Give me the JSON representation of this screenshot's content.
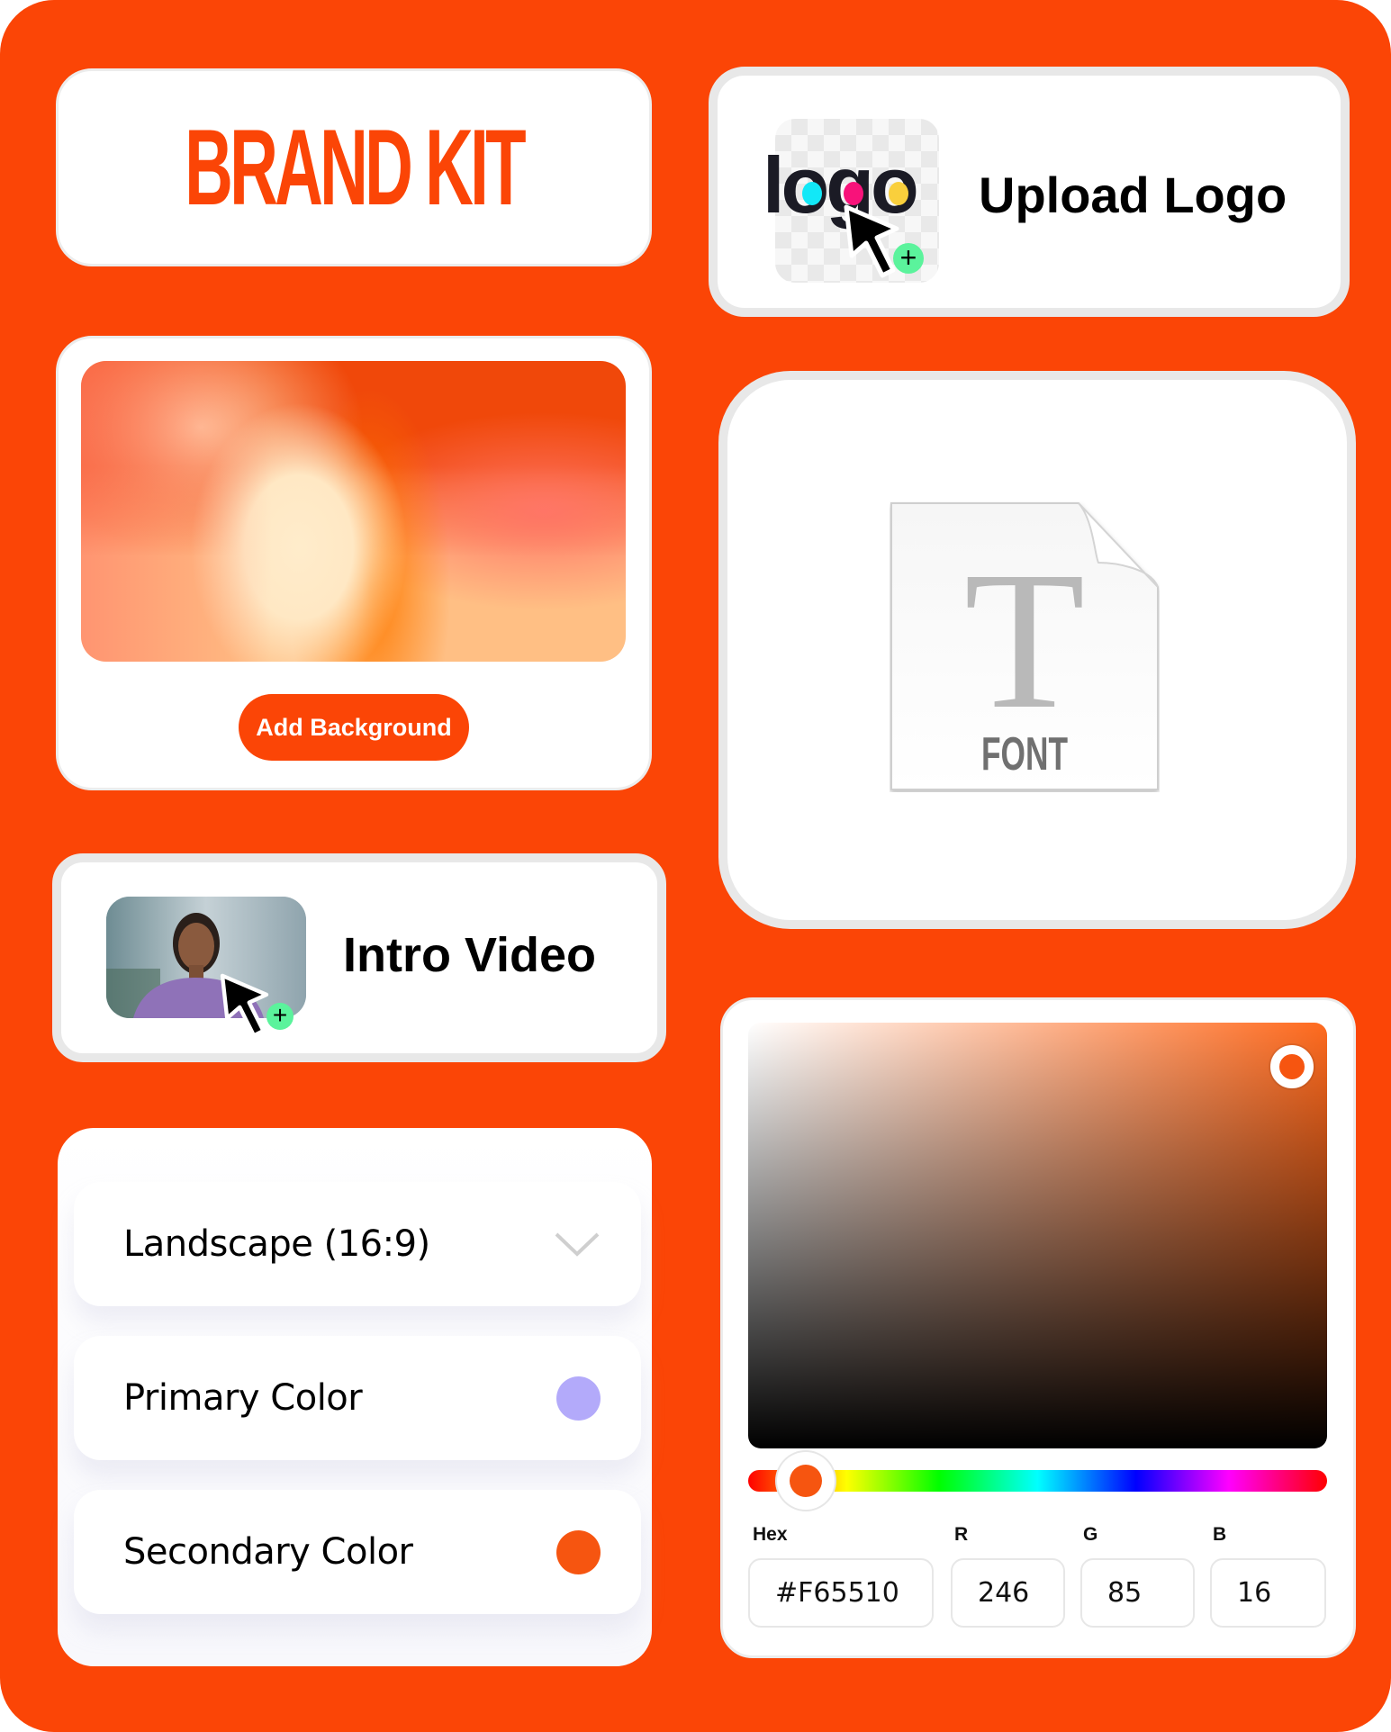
{
  "brand_kit": {
    "title": "BRAND KIT"
  },
  "upload_logo": {
    "label": "Upload Logo",
    "logo_text": "logo",
    "logo_dot_colors": [
      "#12e8f7",
      "#f8127a",
      "#f9cf3c"
    ],
    "badge": "+"
  },
  "background": {
    "button_label": "Add Background"
  },
  "font": {
    "file_glyph": "T",
    "file_label": "FONT"
  },
  "intro_video": {
    "label": "Intro Video",
    "badge": "+"
  },
  "settings": {
    "aspect_ratio": {
      "value": "Landscape (16:9)"
    },
    "primary_color": {
      "label": "Primary Color",
      "color": "#b3aafa"
    },
    "secondary_color": {
      "label": "Secondary Color",
      "color": "#f65510"
    }
  },
  "color_picker": {
    "selected_color": "#f65510",
    "hue_position": 0.1,
    "saturation": 0.94,
    "brightness": 0.96,
    "labels": {
      "hex": "Hex",
      "r": "R",
      "g": "G",
      "b": "B"
    },
    "hex": "#F65510",
    "r": "246",
    "g": "85",
    "b": "16"
  },
  "colors": {
    "accent": "#fb4506",
    "add_badge": "#5bf39c"
  }
}
